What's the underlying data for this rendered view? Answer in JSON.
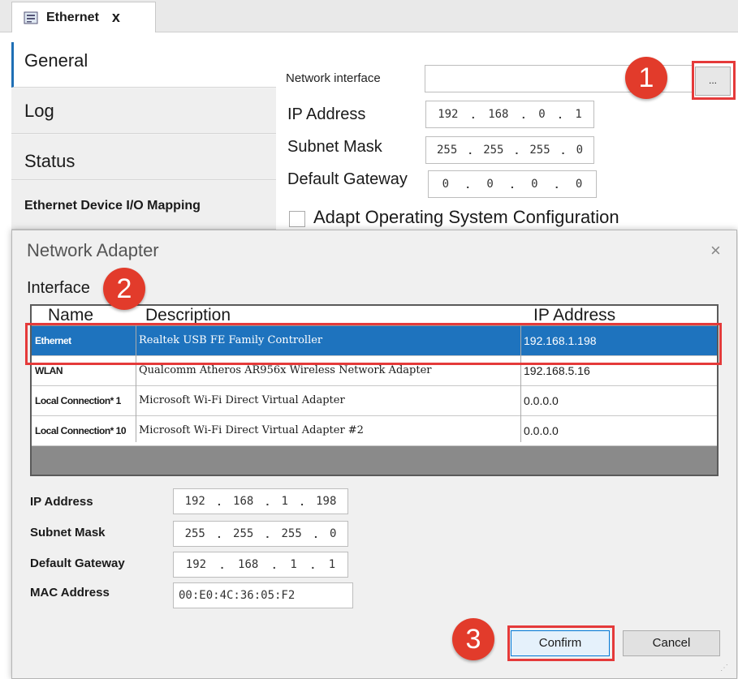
{
  "tab": {
    "title": "Ethernet",
    "close": "x"
  },
  "nav": {
    "general": "General",
    "log": "Log",
    "status": "Status",
    "mapping": "Ethernet Device I/O Mapping"
  },
  "general": {
    "network_interface_label": "Network interface",
    "network_interface_value": "",
    "browse_label": "...",
    "ip_label": "IP Address",
    "ip": [
      "192",
      "168",
      "0",
      "1"
    ],
    "subnet_label": "Subnet Mask",
    "subnet": [
      "255",
      "255",
      "255",
      "0"
    ],
    "gateway_label": "Default Gateway",
    "gateway": [
      "0",
      "0",
      "0",
      "0"
    ],
    "adapt_label": "Adapt Operating System Configuration"
  },
  "dialog": {
    "title": "Network Adapter",
    "close": "×",
    "interface_label": "Interface",
    "columns": {
      "name": "Name",
      "description": "Description",
      "ip": "IP Address"
    },
    "rows": [
      {
        "name": "Ethernet",
        "description": "Realtek USB FE Family Controller",
        "ip": "192.168.1.198"
      },
      {
        "name": "WLAN",
        "description": "Qualcomm Atheros AR956x Wireless Network Adapter",
        "ip": "192.168.5.16"
      },
      {
        "name": "Local Connection* 1",
        "description": "Microsoft Wi-Fi Direct Virtual Adapter",
        "ip": "0.0.0.0"
      },
      {
        "name": "Local Connection* 10",
        "description": "Microsoft Wi-Fi Direct Virtual Adapter #2",
        "ip": "0.0.0.0"
      }
    ],
    "selected_row": 0,
    "ip_label": "IP Address",
    "ip": [
      "192",
      "168",
      "1",
      "198"
    ],
    "subnet_label": "Subnet Mask",
    "subnet": [
      "255",
      "255",
      "255",
      "0"
    ],
    "gateway_label": "Default Gateway",
    "gateway": [
      "192",
      "168",
      "1",
      "1"
    ],
    "mac_label": "MAC Address",
    "mac": "00:E0:4C:36:05:F2",
    "confirm": "Confirm",
    "cancel": "Cancel"
  },
  "badges": {
    "step1": "1",
    "step2": "2",
    "step3": "3"
  },
  "colors": {
    "highlight": "#e53a3a",
    "selection": "#1e73be",
    "badge": "#e23b2b",
    "accent": "#1f6fb5"
  }
}
